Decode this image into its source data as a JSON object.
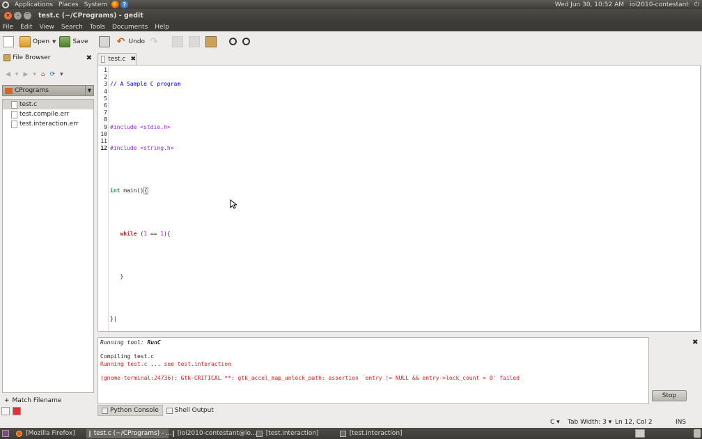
{
  "top_panel": {
    "menus": [
      "Applications",
      "Places",
      "System"
    ],
    "datetime": "Wed Jun 30, 10:52 AM",
    "user": "ioi2010-contestant"
  },
  "window": {
    "title": "test.c (~/CPrograms) - gedit"
  },
  "menubar": [
    "File",
    "Edit",
    "View",
    "Search",
    "Tools",
    "Documents",
    "Help"
  ],
  "toolbar": {
    "open_label": "Open",
    "save_label": "Save",
    "undo_label": "Undo"
  },
  "sidebar": {
    "title": "File Browser",
    "folder": "CPrograms",
    "files": [
      "test.c",
      "test.compile.err",
      "test.interaction.err"
    ],
    "selected_file": "test.c",
    "match_filename": "Match Filename"
  },
  "editor": {
    "tab_label": "test.c",
    "current_line": 12,
    "lines": [
      "// A Sample C program",
      "",
      "#include <stdio.h>",
      "#include <string.h>",
      "",
      "int main()",
      "",
      "   while (1 == 1){",
      "",
      "   }",
      "",
      "}"
    ]
  },
  "shell_output": {
    "running_tool_label": "Running tool:",
    "tool_name": "RunC",
    "lines": [
      "Compiling test.c",
      "Running test.c ... see test.interaction",
      "(gnome-terminal:24736): Gtk-CRITICAL **: gtk_accel_map_unlock_path: assertion `entry != NULL && entry->lock_count > 0' failed"
    ],
    "stop_label": "Stop"
  },
  "bottom_tabs": [
    "Python Console",
    "Shell Output"
  ],
  "statusbar": {
    "language": "C",
    "tab_width": "Tab Width:  3",
    "position": "Ln 12, Col 2",
    "mode": "INS"
  },
  "taskbar": {
    "tasks": [
      "[Mozilla Firefox]",
      "test.c (~/CPrograms) - ...",
      "[ioi2010-contestant@io...",
      "[test.interaction]",
      "[test.interaction]"
    ]
  }
}
